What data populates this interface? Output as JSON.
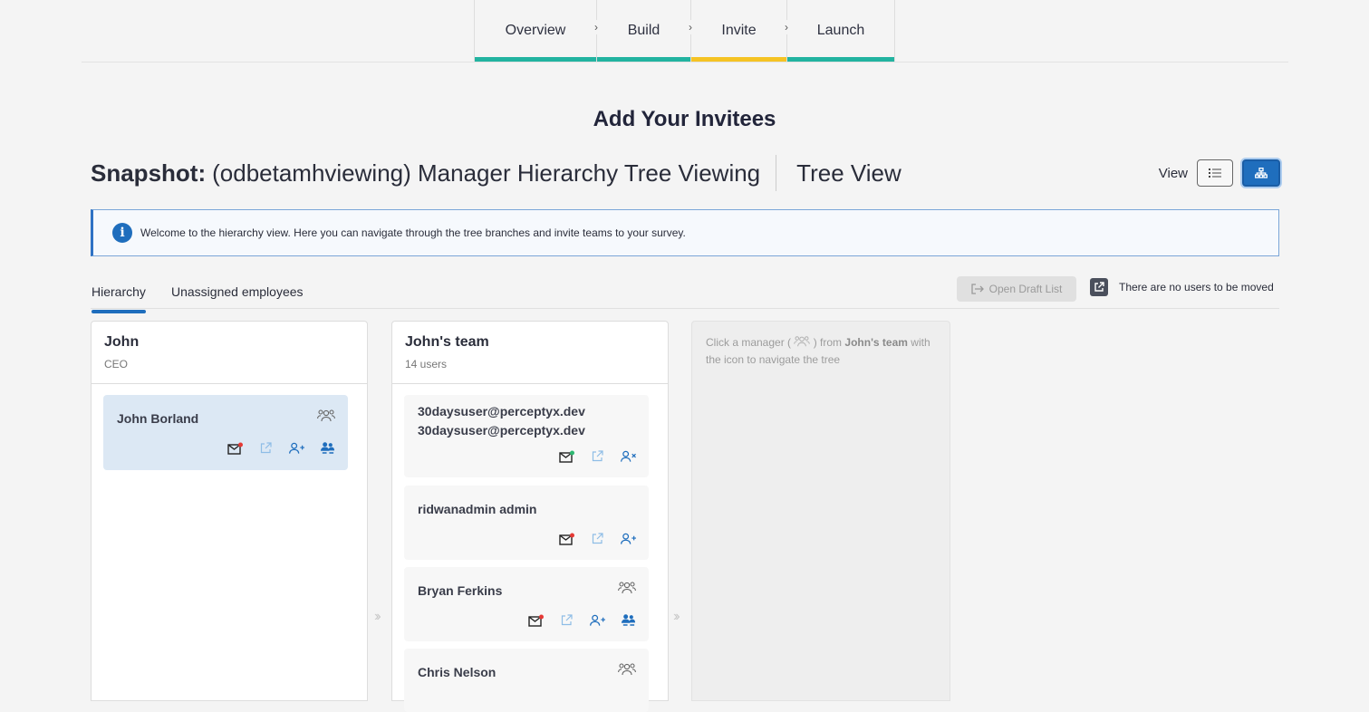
{
  "stepper": {
    "steps": [
      {
        "label": "Overview"
      },
      {
        "label": "Build"
      },
      {
        "label": "Invite"
      },
      {
        "label": "Launch"
      }
    ]
  },
  "page": {
    "title": "Add Your Invitees"
  },
  "snapshot": {
    "prefix": "Snapshot:",
    "name": "(odbetamhviewing) Manager Hierarchy Tree Viewing",
    "view_name": "Tree View"
  },
  "view_switch": {
    "label": "View"
  },
  "banner": {
    "icon": "info-icon",
    "text": "Welcome to the hierarchy view. Here you can navigate through the tree branches and invite teams to your survey."
  },
  "tabs": {
    "hierarchy": "Hierarchy",
    "unassigned": "Unassigned employees",
    "open_draft": "Open Draft List",
    "no_users_moved": "There are no users to be moved"
  },
  "columns": {
    "root": {
      "name": "John",
      "subtitle": "CEO"
    },
    "team": {
      "name": "John's team",
      "subtitle": "14 users"
    },
    "empty": {
      "prefix": "Click a manager (",
      "middle": ") from",
      "team": "John's team",
      "suffix": "with the icon to navigate the tree"
    }
  },
  "cards": {
    "root": {
      "name": "John Borland"
    },
    "team": [
      {
        "name": "30daysuser@perceptyx.dev 30daysuser@perceptyx.dev"
      },
      {
        "name": "ridwanadmin admin"
      },
      {
        "name": "Bryan Ferkins"
      },
      {
        "name": "Chris Nelson"
      }
    ]
  },
  "colors": {
    "accent": "#1f6ebd",
    "step_done": "#22b3a0",
    "step_active": "#f5c324",
    "mail_badge_red": "#e53935",
    "mail_badge_green": "#2eb872"
  }
}
